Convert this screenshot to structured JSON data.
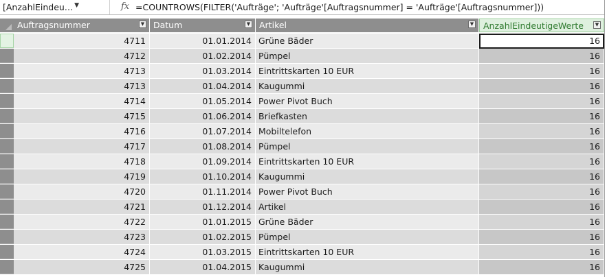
{
  "formula_bar": {
    "name_box": "[AnzahlEindeu…",
    "name_box_dropdown": "▼",
    "fx_icon": "fx",
    "formula": "=COUNTROWS(FILTER('Aufträge'; 'Aufträge'[Auftragsnummer] = 'Aufträge'[Auftragsnummer]))"
  },
  "grid": {
    "columns": [
      {
        "label": "Auftragsnummer"
      },
      {
        "label": "Datum"
      },
      {
        "label": "Artikel"
      },
      {
        "label": "AnzahlEindeutigeWerte"
      }
    ],
    "rows": [
      [
        "4711",
        "01.01.2014",
        "Grüne Bäder",
        "16"
      ],
      [
        "4712",
        "01.02.2014",
        "Pümpel",
        "16"
      ],
      [
        "4713",
        "01.03.2014",
        "Eintrittskarten 10 EUR",
        "16"
      ],
      [
        "4713",
        "01.04.2014",
        "Kaugummi",
        "16"
      ],
      [
        "4714",
        "01.05.2014",
        "Power Pivot Buch",
        "16"
      ],
      [
        "4715",
        "01.06.2014",
        "Briefkasten",
        "16"
      ],
      [
        "4716",
        "01.07.2014",
        "Mobiltelefon",
        "16"
      ],
      [
        "4717",
        "01.08.2014",
        "Pümpel",
        "16"
      ],
      [
        "4718",
        "01.09.2014",
        "Eintrittskarten 10 EUR",
        "16"
      ],
      [
        "4719",
        "01.10.2014",
        "Kaugummi",
        "16"
      ],
      [
        "4720",
        "01.11.2014",
        "Power Pivot Buch",
        "16"
      ],
      [
        "4721",
        "01.12.2014",
        "Artikel",
        "16"
      ],
      [
        "4722",
        "01.01.2015",
        "Grüne Bäder",
        "16"
      ],
      [
        "4723",
        "01.02.2015",
        "Pümpel",
        "16"
      ],
      [
        "4724",
        "01.03.2015",
        "Eintrittskarten 10 EUR",
        "16"
      ],
      [
        "4725",
        "01.04.2015",
        "Kaugummi",
        "16"
      ]
    ]
  },
  "colors": {
    "header_bg": "#8e8e8e",
    "selected_header_bg": "#dff0df",
    "selected_header_text": "#2f7a2f",
    "row_odd": "#ebebeb",
    "row_even": "#dcdcdc"
  }
}
